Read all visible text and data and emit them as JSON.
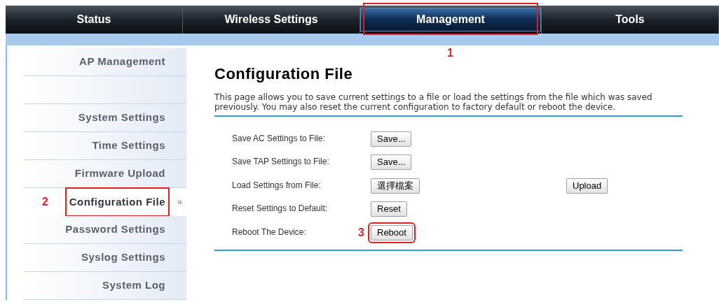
{
  "tabs": [
    {
      "label": "Status",
      "selected": false
    },
    {
      "label": "Wireless Settings",
      "selected": false
    },
    {
      "label": "Management",
      "selected": true,
      "callout": "1"
    },
    {
      "label": "Tools",
      "selected": false
    }
  ],
  "sidebar": {
    "items": [
      {
        "label": "AP Management",
        "selected": false,
        "kind": "heading"
      },
      {
        "kind": "spacer"
      },
      {
        "label": "System Settings",
        "selected": false,
        "kind": "link"
      },
      {
        "label": "Time Settings",
        "selected": false,
        "kind": "link"
      },
      {
        "label": "Firmware Upload",
        "selected": false,
        "kind": "link"
      },
      {
        "label": "Configuration File",
        "selected": true,
        "kind": "link",
        "marker": "»",
        "callout": "2"
      },
      {
        "label": "Password Settings",
        "selected": false,
        "kind": "link"
      },
      {
        "label": "Syslog Settings",
        "selected": false,
        "kind": "link"
      },
      {
        "label": "System Log",
        "selected": false,
        "kind": "link"
      }
    ]
  },
  "title": "Configuration File",
  "description": "This page allows you to save current settings to a file or load the settings from the file which was saved previously. You may also reset the current configuration to factory default or reboot the device.",
  "rows": [
    {
      "label": "Save AC Settings to File:",
      "buttons": [
        "Save..."
      ]
    },
    {
      "label": "Save TAP Settings to File:",
      "buttons": [
        "Save..."
      ]
    },
    {
      "label": "Load Settings from File:",
      "buttons": [
        "選擇檔案",
        "Upload"
      ]
    },
    {
      "label": "Reset Settings to Default:",
      "buttons": [
        "Reset"
      ]
    },
    {
      "label": "Reboot The Device:",
      "buttons": [
        "Reboot"
      ],
      "callout": "3"
    }
  ]
}
